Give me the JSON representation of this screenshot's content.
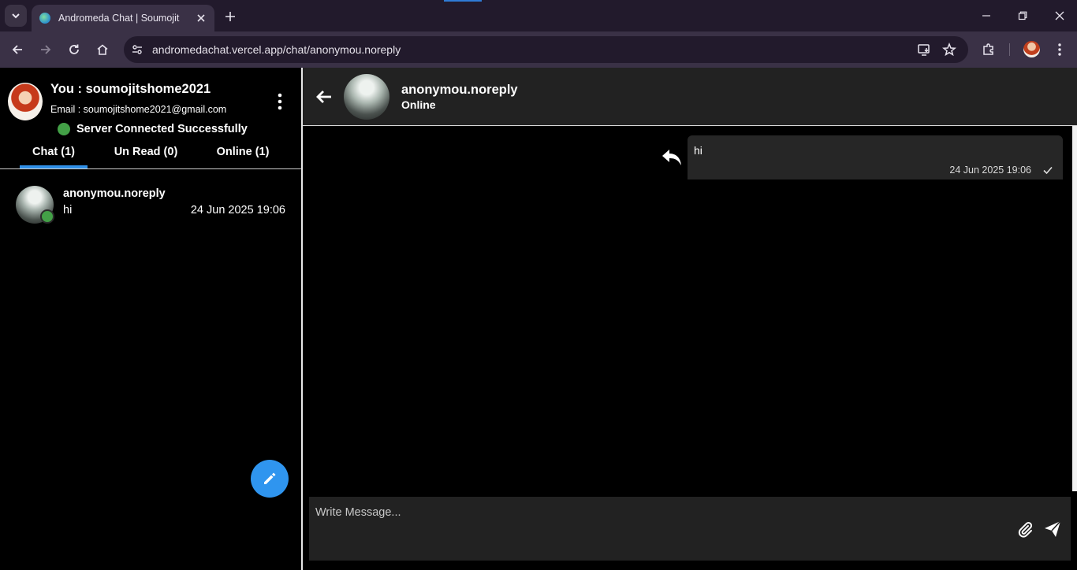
{
  "browser": {
    "tab_title": "Andromeda Chat | Soumojit",
    "url": "andromedachat.vercel.app/chat/anonymou.noreply"
  },
  "sidebar": {
    "user_title": "You : soumojitshome2021",
    "user_email": "Email : soumojitshome2021@gmail.com",
    "server_status": "Server Connected Successfully",
    "tabs": [
      {
        "label": "Chat (1)"
      },
      {
        "label": "Un Read (0)"
      },
      {
        "label": "Online (1)"
      }
    ],
    "chats": [
      {
        "name": "anonymou.noreply",
        "last_message": "hi",
        "time": "24 Jun 2025 19:06"
      }
    ]
  },
  "chat": {
    "contact_name": "anonymou.noreply",
    "contact_status": "Online",
    "messages": [
      {
        "text": "hi",
        "time": "24 Jun 2025 19:06"
      }
    ],
    "composer_placeholder": "Write Message..."
  },
  "colors": {
    "accent": "#2f95ef",
    "online": "#43a047"
  }
}
